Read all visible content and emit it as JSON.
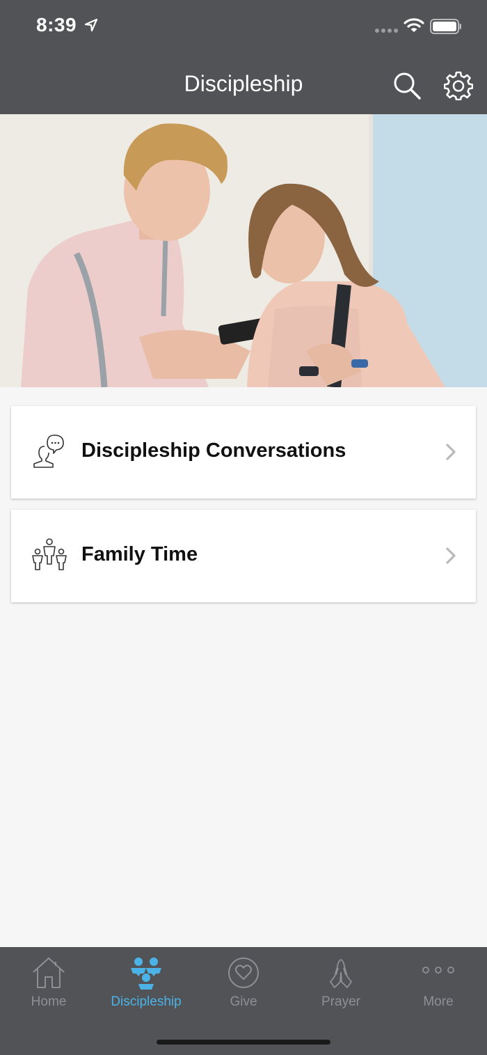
{
  "status_bar": {
    "time": "8:39"
  },
  "nav": {
    "title": "Discipleship",
    "search_icon": "search-icon",
    "settings_icon": "gear-icon"
  },
  "menu": [
    {
      "label": "Discipleship Conversations",
      "icon": "conversation-icon"
    },
    {
      "label": "Family Time",
      "icon": "family-icon"
    }
  ],
  "tabs": [
    {
      "label": "Home",
      "icon": "home-icon",
      "active": false
    },
    {
      "label": "Discipleship",
      "icon": "discipleship-icon",
      "active": true
    },
    {
      "label": "Give",
      "icon": "heart-icon",
      "active": false
    },
    {
      "label": "Prayer",
      "icon": "praying-hands-icon",
      "active": false
    },
    {
      "label": "More",
      "icon": "more-dots-icon",
      "active": false
    }
  ],
  "colors": {
    "bar_background": "#515357",
    "accent": "#4bb3e6",
    "inactive_tab": "#8e9095",
    "page_background": "#f6f6f6"
  }
}
